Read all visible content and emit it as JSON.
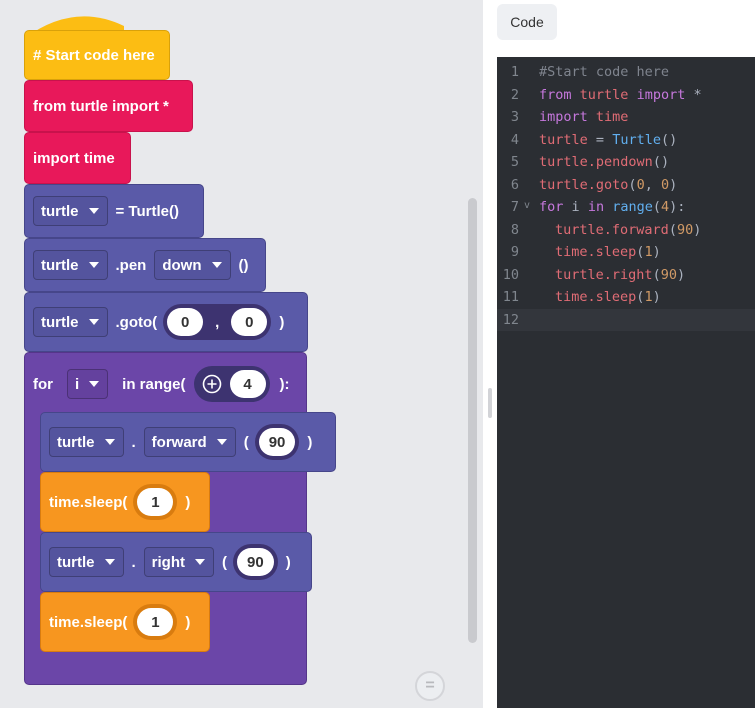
{
  "blocks": {
    "comment": "# Start code here",
    "import_turtle": "from turtle import *",
    "import_time": "import time",
    "turtle_var": "turtle",
    "assign_text": "= Turtle()",
    "pen_label": ".pen",
    "pen_state": "down",
    "empty_call": "()",
    "goto_label": ".goto(",
    "goto_x": "0",
    "goto_comma": ",",
    "goto_y": "0",
    "close_paren": ")",
    "for_label": "for",
    "loop_var": "i",
    "in_range_label": "in range(",
    "range_value": "4",
    "range_close": "):",
    "dot": ".",
    "forward_method": "forward",
    "open_paren": "(",
    "forward_value": "90",
    "sleep_label": "time.sleep(",
    "sleep_value_1": "1",
    "right_method": "right",
    "right_value": "90",
    "sleep_value_2": "1",
    "eq_button": "="
  },
  "colors": {
    "comment_block": "#fcbd13",
    "import_block": "#e8185a",
    "turtle_block": "#5a5aa8",
    "loop_block": "#6b46a8",
    "sleep_block": "#f7961f",
    "editor_bg": "#2b2e33"
  },
  "code_panel": {
    "tab_label": "Code",
    "line_numbers": [
      "1",
      "2",
      "3",
      "4",
      "5",
      "6",
      "7",
      "8",
      "9",
      "10",
      "11",
      "12"
    ],
    "lines": {
      "l1": "#Start code here",
      "l2_kw1": "from",
      "l2_mod": "turtle",
      "l2_kw2": "import",
      "l2_star": "*",
      "l3_kw": "import",
      "l3_mod": "time",
      "l4_var": "turtle",
      "l4_eq": "=",
      "l4_fn": "Turtle",
      "l4_paren": "()",
      "l5_var": "turtle",
      "l5_method": ".pendown",
      "l5_paren": "()",
      "l6_var": "turtle",
      "l6_method": ".goto",
      "l6_open": "(",
      "l6_a": "0",
      "l6_comma": ", ",
      "l6_b": "0",
      "l6_close": ")",
      "l7_kw1": "for",
      "l7_var": "i",
      "l7_kw2": "in",
      "l7_fn": "range",
      "l7_open": "(",
      "l7_num": "4",
      "l7_close": "):",
      "l8_var": "turtle",
      "l8_method": ".forward",
      "l8_open": "(",
      "l8_num": "90",
      "l8_close": ")",
      "l9_var": "time",
      "l9_method": ".sleep",
      "l9_open": "(",
      "l9_num": "1",
      "l9_close": ")",
      "l10_var": "turtle",
      "l10_method": ".right",
      "l10_open": "(",
      "l10_num": "90",
      "l10_close": ")",
      "l11_var": "time",
      "l11_method": ".sleep",
      "l11_open": "(",
      "l11_num": "1",
      "l11_close": ")"
    },
    "fold_marker": "v"
  }
}
